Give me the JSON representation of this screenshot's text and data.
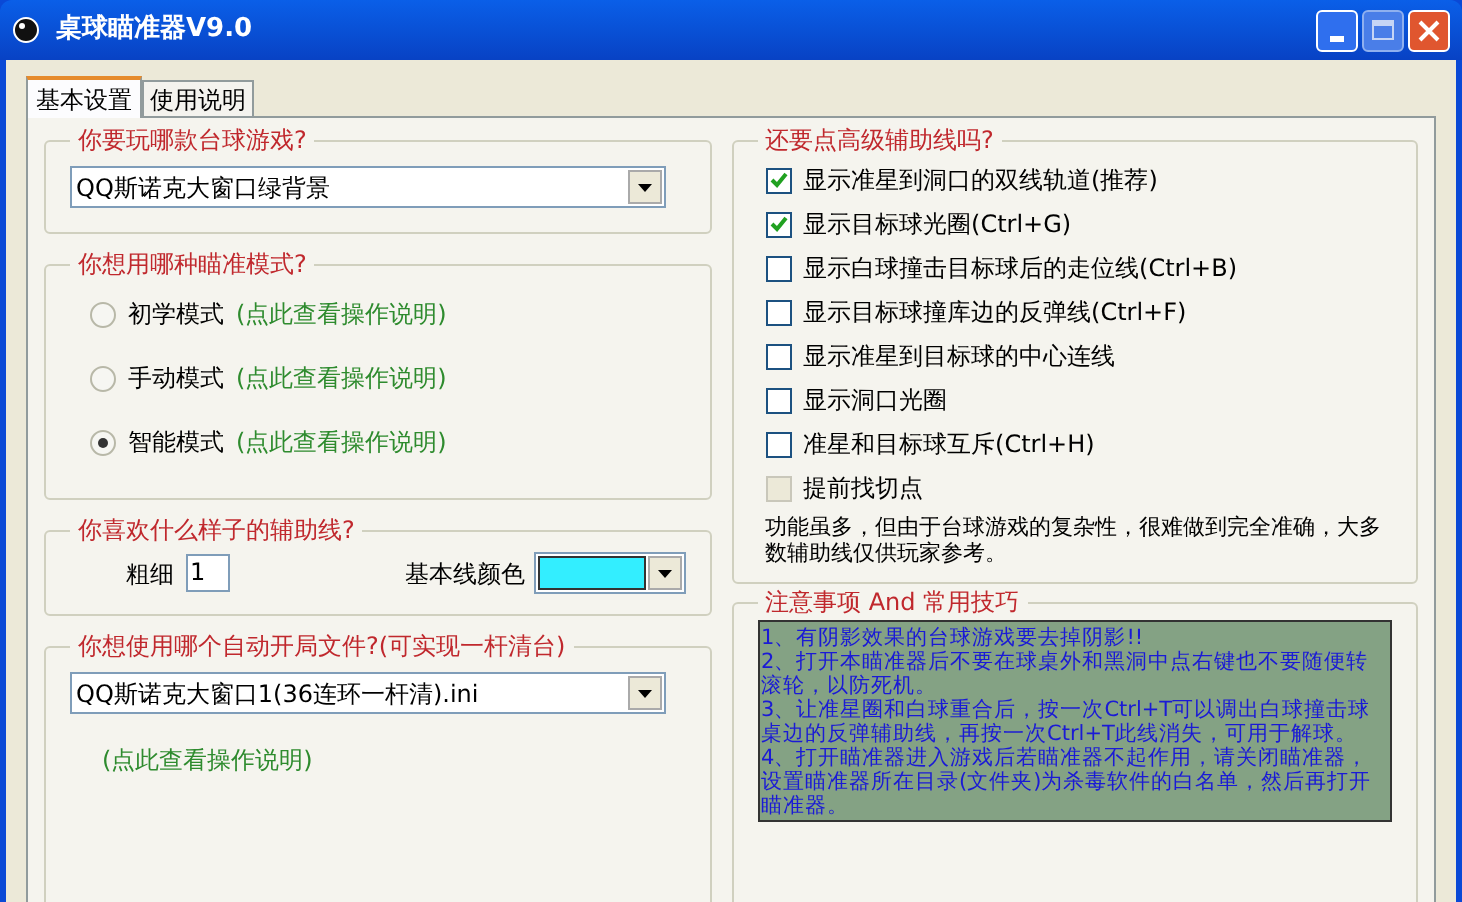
{
  "window": {
    "title": "桌球瞄准器V9.0"
  },
  "tabs": [
    {
      "label": "基本设置",
      "selected": true
    },
    {
      "label": "使用说明",
      "selected": false
    }
  ],
  "game": {
    "legend": "你要玩哪款台球游戏?",
    "value": "QQ斯诺克大窗口绿背景"
  },
  "mode": {
    "legend": "你想用哪种瞄准模式?",
    "options": [
      {
        "label": "初学模式",
        "link": "(点此查看操作说明)",
        "selected": false
      },
      {
        "label": "手动模式",
        "link": "(点此查看操作说明)",
        "selected": false
      },
      {
        "label": "智能模式",
        "link": "(点此查看操作说明)",
        "selected": true
      }
    ]
  },
  "line_style": {
    "legend": "你喜欢什么样子的辅助线?",
    "thickness_label": "粗细",
    "thickness_value": "1",
    "color_label": "基本线颜色",
    "color": "#33eeff"
  },
  "autostart": {
    "legend": "你想使用哪个自动开局文件?(可实现一杆清台)",
    "value": "QQ斯诺克大窗口1(36连环一杆清).ini",
    "link": "(点此查看操作说明)"
  },
  "advanced": {
    "legend": "还要点高级辅助线吗?",
    "options": [
      {
        "label": "显示准星到洞口的双线轨道(推荐)",
        "checked": true,
        "disabled": false
      },
      {
        "label": "显示目标球光圈(Ctrl+G)",
        "checked": true,
        "disabled": false
      },
      {
        "label": "显示白球撞击目标球后的走位线(Ctrl+B)",
        "checked": false,
        "disabled": false
      },
      {
        "label": "显示目标球撞库边的反弹线(Ctrl+F)",
        "checked": false,
        "disabled": false
      },
      {
        "label": "显示准星到目标球的中心连线",
        "checked": false,
        "disabled": false
      },
      {
        "label": "显示洞口光圈",
        "checked": false,
        "disabled": false
      },
      {
        "label": "准星和目标球互斥(Ctrl+H)",
        "checked": false,
        "disabled": false
      },
      {
        "label": "提前找切点",
        "checked": false,
        "disabled": true
      }
    ],
    "note": "功能虽多，但由于台球游戏的复杂性，很难做到完全准确，大多数辅助线仅供玩家参考。"
  },
  "tips": {
    "legend": "注意事项 And 常用技巧",
    "items": [
      "1、有阴影效果的台球游戏要去掉阴影!!",
      "2、打开本瞄准器后不要在球桌外和黑洞中点右键也不要随便转滚轮，以防死机。",
      "3、让准星圈和白球重合后，按一次Ctrl+T可以调出白球撞击球桌边的反弹辅助线，再按一次Ctrl+T此线消失，可用于解球。",
      "4、打开瞄准器进入游戏后若瞄准器不起作用，请关闭瞄准器，设置瞄准器所在目录(文件夹)为杀毒软件的白名单，然后再打开瞄准器。"
    ]
  }
}
